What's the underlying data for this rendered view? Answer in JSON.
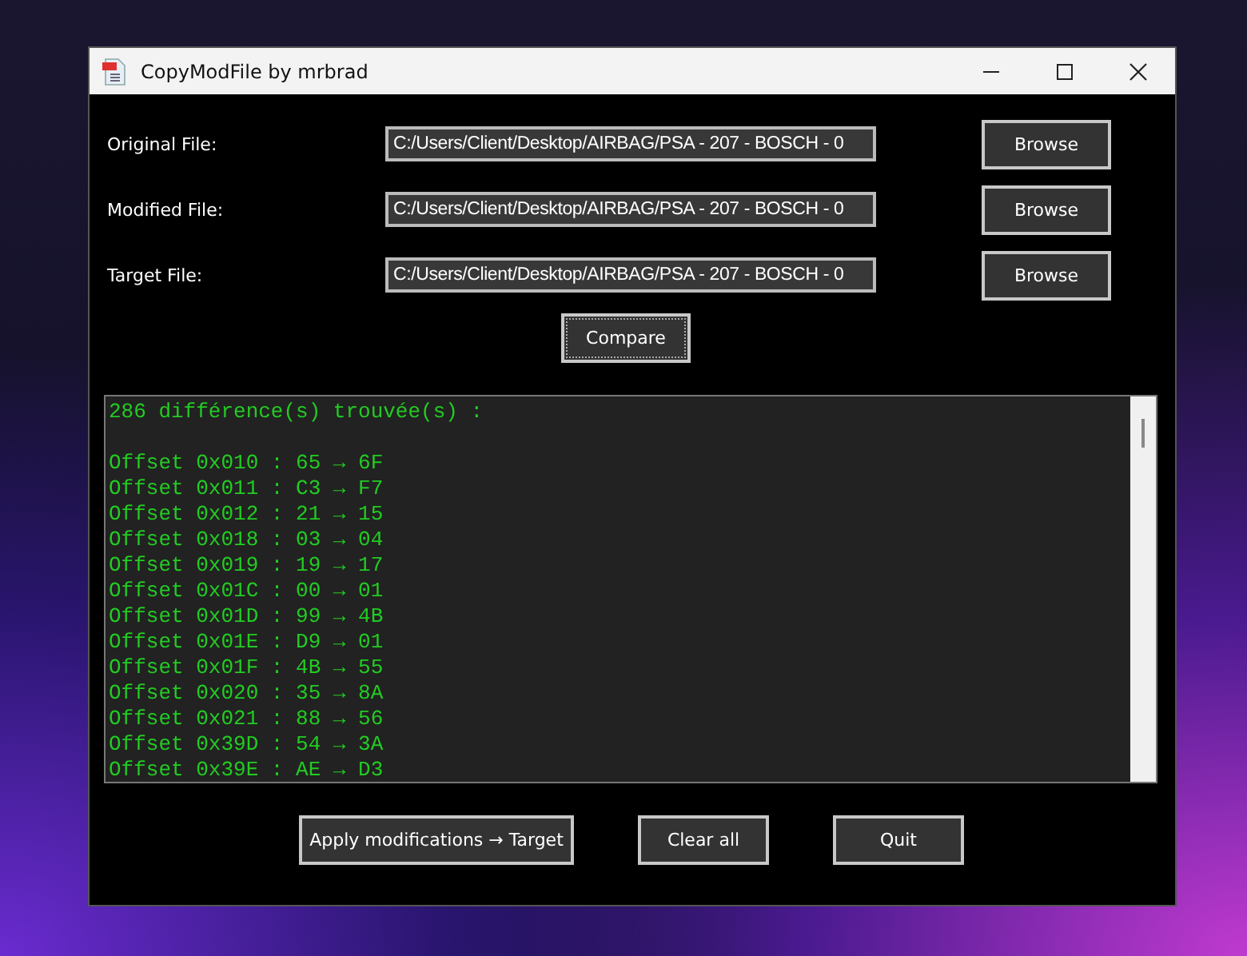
{
  "window": {
    "title": "CopyModFile by mrbrad"
  },
  "files": [
    {
      "label": "Original File:",
      "value": "C:/Users/Client/Desktop/AIRBAG/PSA - 207 - BOSCH - 0",
      "button": "Browse"
    },
    {
      "label": "Modified File:",
      "value": "C:/Users/Client/Desktop/AIRBAG/PSA - 207 - BOSCH - 0",
      "button": "Browse"
    },
    {
      "label": "Target File:",
      "value": "C:/Users/Client/Desktop/AIRBAG/PSA - 207 - BOSCH - 0",
      "button": "Browse"
    }
  ],
  "compare_button": "Compare",
  "output": {
    "header": "286 différence(s) trouvée(s) :",
    "lines": [
      "Offset 0x010 : 65 → 6F",
      "Offset 0x011 : C3 → F7",
      "Offset 0x012 : 21 → 15",
      "Offset 0x018 : 03 → 04",
      "Offset 0x019 : 19 → 17",
      "Offset 0x01C : 00 → 01",
      "Offset 0x01D : 99 → 4B",
      "Offset 0x01E : D9 → 01",
      "Offset 0x01F : 4B → 55",
      "Offset 0x020 : 35 → 8A",
      "Offset 0x021 : 88 → 56",
      "Offset 0x39D : 54 → 3A",
      "Offset 0x39E : AE → D3"
    ]
  },
  "buttons": [
    "Apply modifications → Target",
    "Clear all",
    "Quit"
  ]
}
